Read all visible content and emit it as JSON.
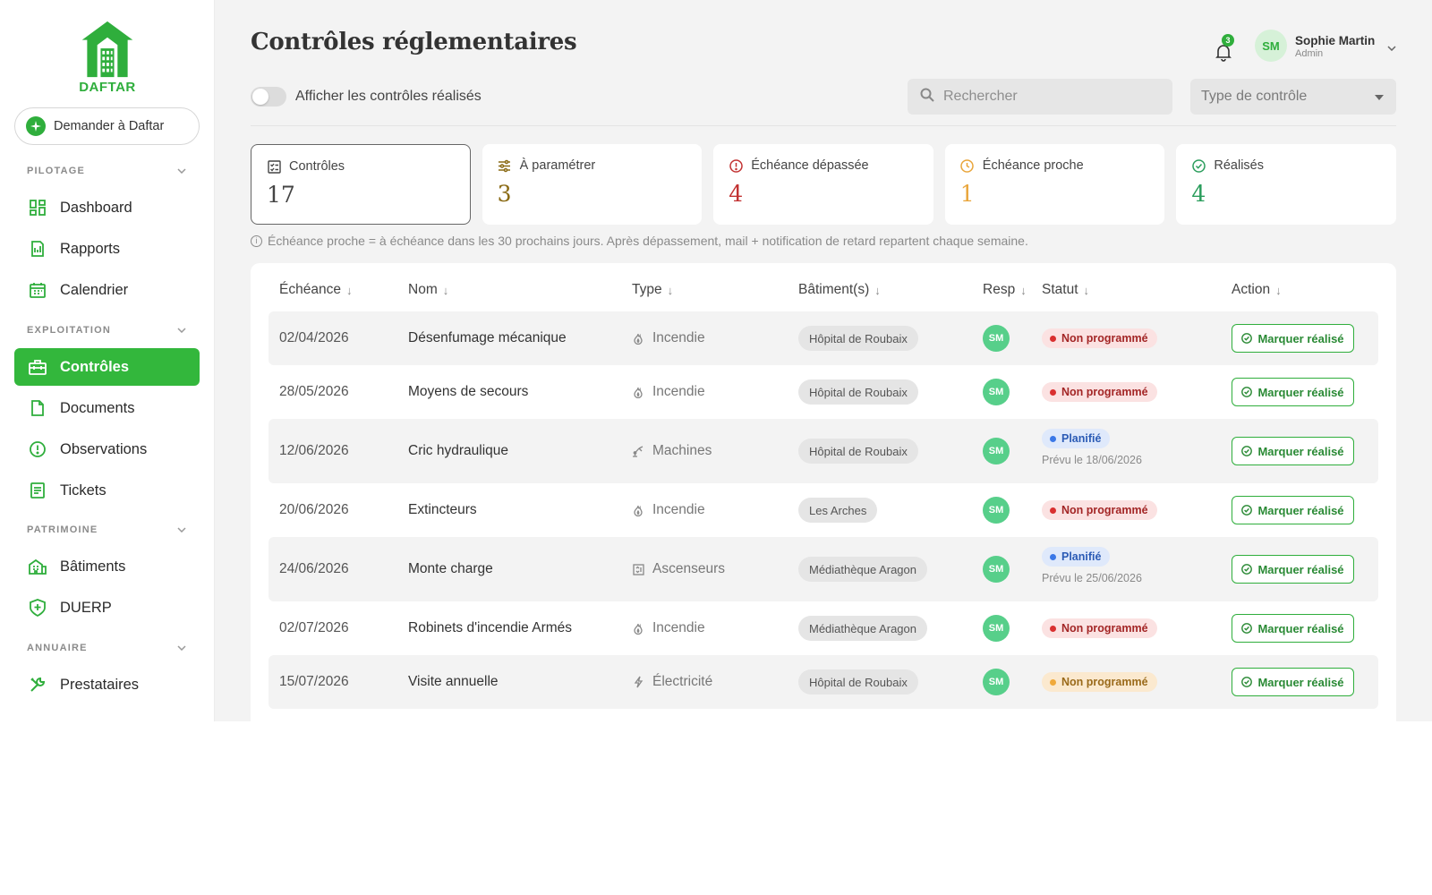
{
  "brand": {
    "name": "DAFTAR",
    "accent": "#33b73c"
  },
  "sidebar": {
    "ask_button": "Demander à Daftar",
    "sections": [
      {
        "title": "PILOTAGE",
        "items": [
          "Dashboard",
          "Rapports",
          "Calendrier"
        ]
      },
      {
        "title": "EXPLOITATION",
        "items": [
          "Contrôles",
          "Documents",
          "Observations",
          "Tickets"
        ]
      },
      {
        "title": "PATRIMOINE",
        "items": [
          "Bâtiments",
          "DUERP"
        ]
      },
      {
        "title": "ANNUAIRE",
        "items": [
          "Prestataires"
        ]
      }
    ],
    "active_item": "Contrôles"
  },
  "header": {
    "title": "Contrôles réglementaires",
    "toggle_label": "Afficher les contrôles réalisés",
    "toggle_on": false,
    "notifications_count": "3",
    "user": {
      "initials": "SM",
      "name": "Sophie Martin",
      "role": "Admin"
    },
    "search_placeholder": "Rechercher",
    "type_filter": "Type de contrôle"
  },
  "cards": [
    {
      "label": "Contrôles",
      "value": "17",
      "icon": "checklist-icon",
      "color": "#444444"
    },
    {
      "label": "À paramétrer",
      "value": "3",
      "icon": "sliders-icon",
      "color": "#8a6a14"
    },
    {
      "label": "Échéance dépassée",
      "value": "4",
      "icon": "alert-circle-icon",
      "color": "#c23232"
    },
    {
      "label": "Échéance proche",
      "value": "1",
      "icon": "clock-icon",
      "color": "#e9a53a"
    },
    {
      "label": "Réalisés",
      "value": "4",
      "icon": "check-circle-icon",
      "color": "#2a9d5c"
    }
  ],
  "hint": "Échéance proche = à échéance dans les 30 prochains jours. Après dépassement, mail + notification de retard repartent chaque semaine.",
  "table": {
    "columns": [
      "Échéance",
      "Nom",
      "Type",
      "Bâtiment(s)",
      "Resp",
      "Statut",
      "Action"
    ],
    "action_label": "Marquer réalisé",
    "rows": [
      {
        "date": "02/04/2026",
        "name": "Désenfumage mécanique",
        "type": "Incendie",
        "type_icon": "flame-icon",
        "building": "Hôpital de Roubaix",
        "resp": "SM",
        "status": "Non programmé",
        "status_color": "red",
        "planned": ""
      },
      {
        "date": "28/05/2026",
        "name": "Moyens de secours",
        "type": "Incendie",
        "type_icon": "flame-icon",
        "building": "Hôpital de Roubaix",
        "resp": "SM",
        "status": "Non programmé",
        "status_color": "red",
        "planned": ""
      },
      {
        "date": "12/06/2026",
        "name": "Cric hydraulique",
        "type": "Machines",
        "type_icon": "machine-icon",
        "building": "Hôpital de Roubaix",
        "resp": "SM",
        "status": "Planifié",
        "status_color": "blue",
        "planned": "Prévu le 18/06/2026"
      },
      {
        "date": "20/06/2026",
        "name": "Extincteurs",
        "type": "Incendie",
        "type_icon": "flame-icon",
        "building": "Les Arches",
        "resp": "SM",
        "status": "Non programmé",
        "status_color": "red",
        "planned": ""
      },
      {
        "date": "24/06/2026",
        "name": "Monte charge",
        "type": "Ascenseurs",
        "type_icon": "elevator-icon",
        "building": "Médiathèque Aragon",
        "resp": "SM",
        "status": "Planifié",
        "status_color": "blue",
        "planned": "Prévu le 25/06/2026"
      },
      {
        "date": "02/07/2026",
        "name": "Robinets d'incendie Armés",
        "type": "Incendie",
        "type_icon": "flame-icon",
        "building": "Médiathèque Aragon",
        "resp": "SM",
        "status": "Non programmé",
        "status_color": "red",
        "planned": ""
      },
      {
        "date": "15/07/2026",
        "name": "Visite annuelle",
        "type": "Électricité",
        "type_icon": "bolt-icon",
        "building": "Hôpital de Roubaix",
        "resp": "SM",
        "status": "Non programmé",
        "status_color": "orange",
        "planned": ""
      }
    ]
  }
}
